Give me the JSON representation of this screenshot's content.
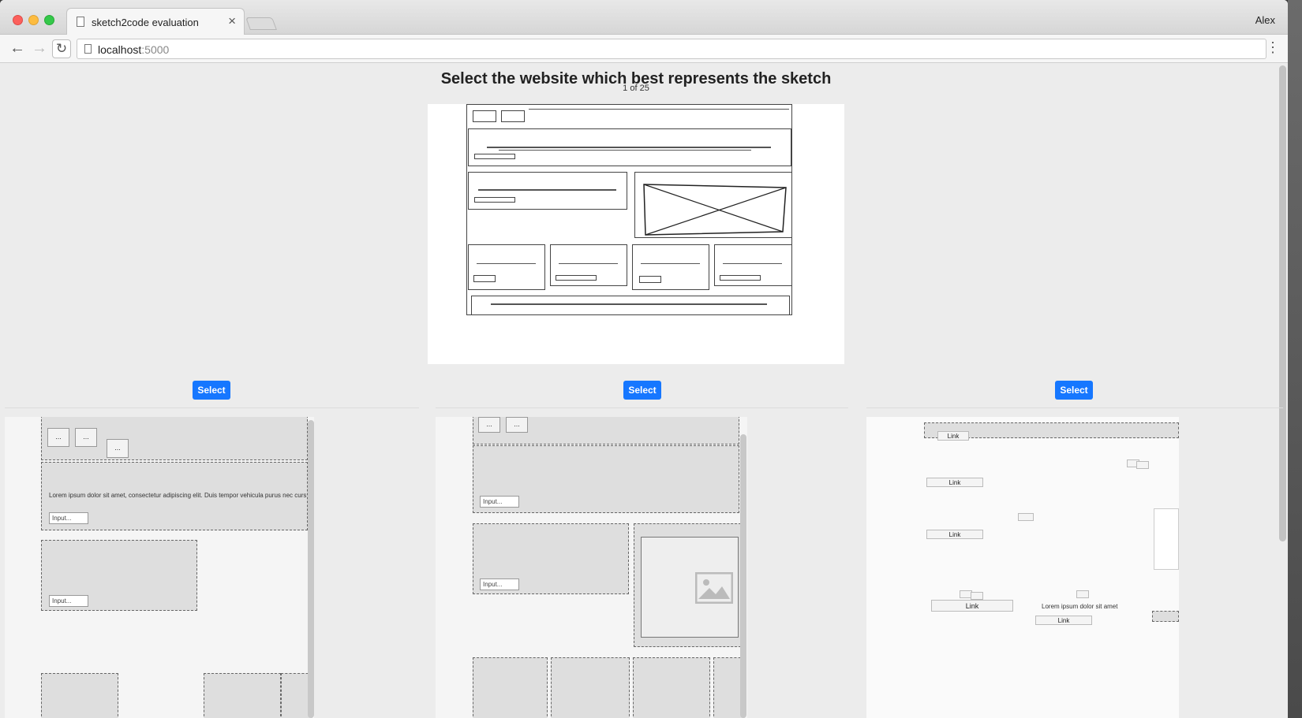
{
  "browser": {
    "tab_title": "sketch2code evaluation",
    "user_name": "Alex",
    "url_host": "localhost",
    "url_port": ":5000"
  },
  "page": {
    "heading": "Select the website which best represents the sketch",
    "counter": "1 of 25",
    "select_label": "Select"
  },
  "previews": {
    "button_dots": "...",
    "input_placeholder": "Input...",
    "lorem": "Lorem ipsum dolor sit amet, consectetur adipiscing elit. Duis tempor vehicula purus nec curs",
    "lorem_short": "Lorem ipsum dolor sit amet",
    "link_label": "Link"
  }
}
